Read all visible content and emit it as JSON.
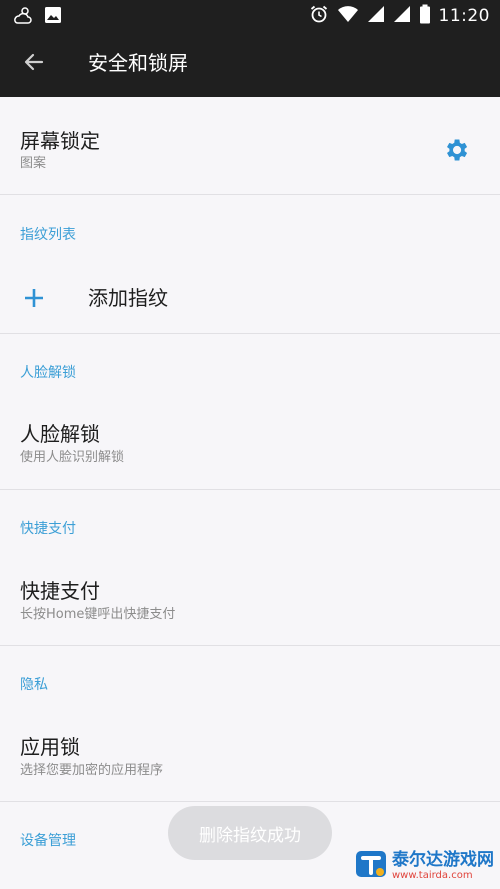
{
  "status_bar": {
    "time": "11:20",
    "icons_left": [
      "weather-cloud-icon",
      "image-icon"
    ],
    "icons_right": [
      "alarm-icon",
      "wifi-icon",
      "signal-icon",
      "signal-icon",
      "battery-icon"
    ]
  },
  "app_bar": {
    "title": "安全和锁屏",
    "back_icon": "arrow-left-icon"
  },
  "items": {
    "screen_lock": {
      "title": "屏幕锁定",
      "subtitle": "图案",
      "action_icon": "gear-icon"
    },
    "fingerprint_section": "指纹列表",
    "add_fingerprint": {
      "title": "添加指纹",
      "icon": "plus-icon"
    },
    "face_section": "人脸解锁",
    "face_unlock": {
      "title": "人脸解锁",
      "subtitle": "使用人脸识别解锁"
    },
    "quick_pay_section": "快捷支付",
    "quick_pay": {
      "title": "快捷支付",
      "subtitle": "长按Home键呼出快捷支付"
    },
    "privacy_section": "隐私",
    "app_lock": {
      "title": "应用锁",
      "subtitle": "选择您要加密的应用程序"
    },
    "device_section": "设备管理"
  },
  "toast": {
    "text": "删除指纹成功"
  },
  "watermark": {
    "title": "泰尔达游戏网",
    "url": "www.tairda.com"
  },
  "colors": {
    "app_bar": "#1f1f1f",
    "background": "#f7f6f9",
    "accent": "#3c9fd6",
    "section_header": "#3c9fd6",
    "toast_bg": "#dcdcdf"
  }
}
